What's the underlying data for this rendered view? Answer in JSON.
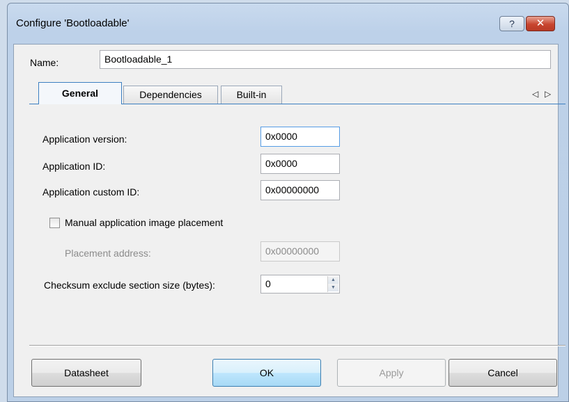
{
  "window": {
    "title": "Configure 'Bootloadable'",
    "help_label": "?",
    "close_label": "✕"
  },
  "name": {
    "label": "Name:",
    "value": "Bootloadable_1"
  },
  "tabs": [
    {
      "label": "General",
      "active": true
    },
    {
      "label": "Dependencies",
      "active": false
    },
    {
      "label": "Built-in",
      "active": false
    }
  ],
  "tab_scroll": {
    "left": "◁",
    "right": "▷"
  },
  "general": {
    "app_version": {
      "label": "Application version:",
      "value": "0x0000"
    },
    "app_id": {
      "label": "Application ID:",
      "value": "0x0000"
    },
    "app_custom_id": {
      "label": "Application custom ID:",
      "value": "0x00000000"
    },
    "manual_placement": {
      "label": "Manual application image placement",
      "checked": false
    },
    "placement_address": {
      "label": "Placement address:",
      "value": "0x00000000",
      "disabled": true
    },
    "checksum_exclude": {
      "label": "Checksum exclude section size (bytes):",
      "value": "0",
      "up": "▲",
      "down": "▼"
    }
  },
  "buttons": {
    "datasheet": "Datasheet",
    "ok": "OK",
    "apply": "Apply",
    "cancel": "Cancel"
  },
  "colors": {
    "accent": "#3c7fc1",
    "close": "#c8452f",
    "title_bg": "#c9daee"
  },
  "icons": [
    "help-icon",
    "close-icon",
    "tab-scroll-left-icon",
    "tab-scroll-right-icon",
    "spin-up-icon",
    "spin-down-icon"
  ]
}
